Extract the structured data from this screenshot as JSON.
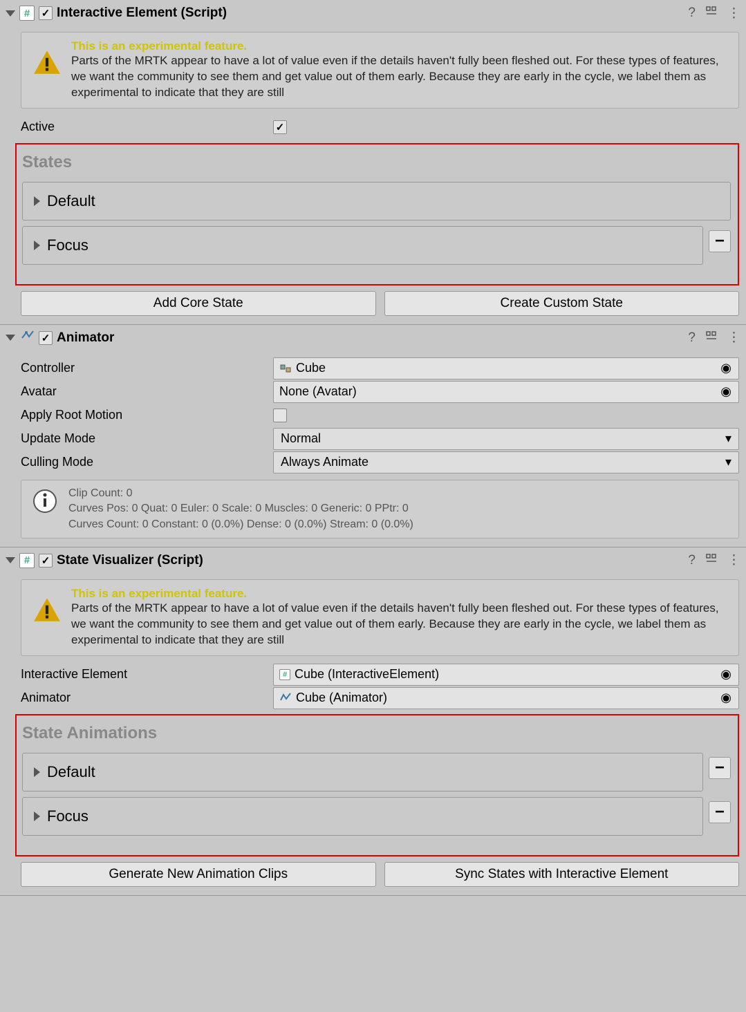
{
  "components": {
    "interactive": {
      "title": "Interactive Element (Script)",
      "warning_title": "This is an experimental feature.",
      "warning_body": "Parts of the MRTK appear to have a lot of value even if the details haven't fully been fleshed out. For these types of features, we want the community to see them and get value out of them early. Because they are early in the cycle, we label them as experimental to indicate that they are still",
      "active_label": "Active",
      "states_title": "States",
      "states": [
        "Default",
        "Focus"
      ],
      "add_core": "Add Core State",
      "create_custom": "Create Custom State"
    },
    "animator": {
      "title": "Animator",
      "controller_label": "Controller",
      "controller_value": "Cube",
      "avatar_label": "Avatar",
      "avatar_value": "None (Avatar)",
      "apply_root_label": "Apply Root Motion",
      "update_mode_label": "Update Mode",
      "update_mode_value": "Normal",
      "culling_mode_label": "Culling Mode",
      "culling_mode_value": "Always Animate",
      "info_line1": "Clip Count: 0",
      "info_line2": "Curves Pos: 0 Quat: 0 Euler: 0 Scale: 0 Muscles: 0 Generic: 0 PPtr: 0",
      "info_line3": "Curves Count: 0 Constant: 0 (0.0%) Dense: 0 (0.0%) Stream: 0 (0.0%)"
    },
    "visualizer": {
      "title": "State Visualizer (Script)",
      "warning_title": "This is an experimental feature.",
      "warning_body": "Parts of the MRTK appear to have a lot of value even if the details haven't fully been fleshed out. For these types of features, we want the community to see them and get value out of them early. Because they are early in the cycle, we label them as experimental to indicate that they are still",
      "interactive_label": "Interactive Element",
      "interactive_value": "Cube (InteractiveElement)",
      "animator_label": "Animator",
      "animator_value": "Cube (Animator)",
      "state_anim_title": "State Animations",
      "states": [
        "Default",
        "Focus"
      ],
      "generate_btn": "Generate New Animation Clips",
      "sync_btn": "Sync States with Interactive Element"
    }
  }
}
